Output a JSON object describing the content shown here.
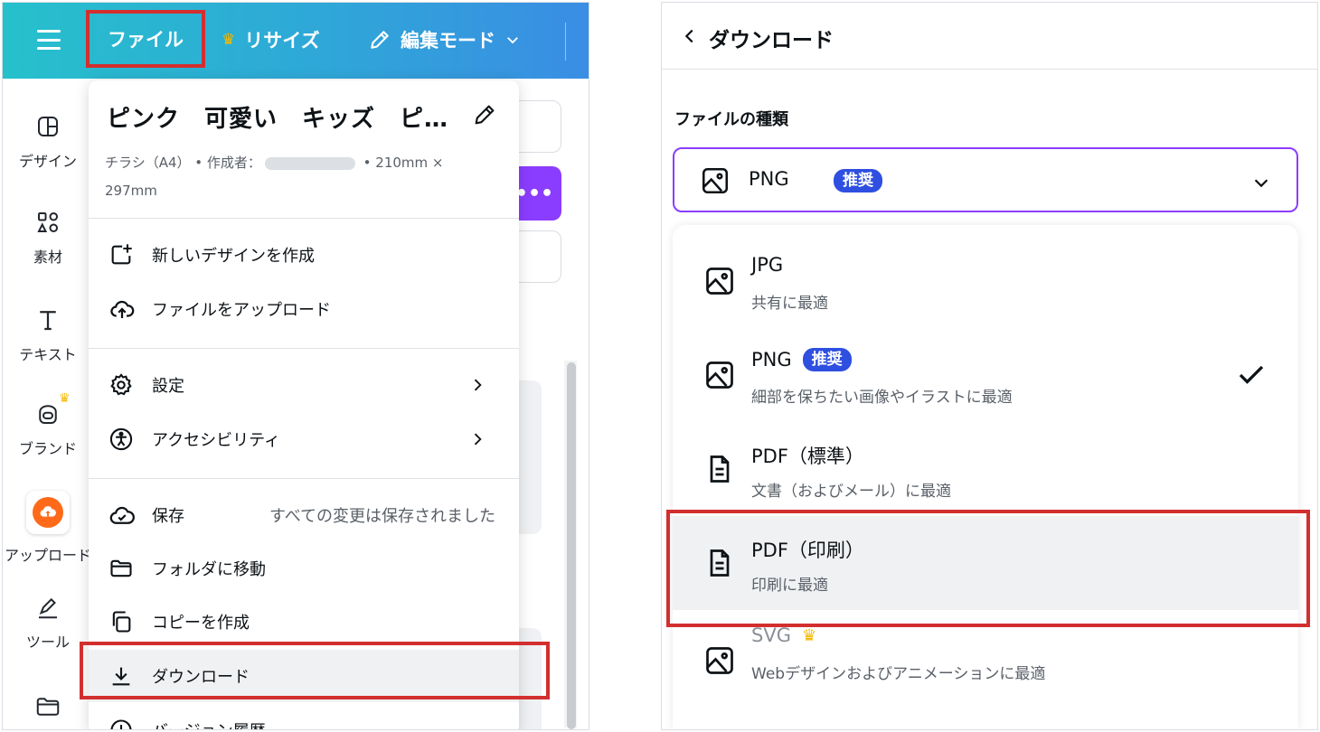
{
  "left": {
    "topbar": {
      "file_label": "ファイル",
      "resize_label": "リサイズ",
      "edit_mode_label": "編集モード"
    },
    "sidebar": {
      "items": [
        {
          "label": "デザイン",
          "icon": "design-icon"
        },
        {
          "label": "素材",
          "icon": "elements-icon"
        },
        {
          "label": "テキスト",
          "icon": "text-icon"
        },
        {
          "label": "ブランド",
          "icon": "brand-icon"
        },
        {
          "label": "アップロード",
          "icon": "upload-icon"
        },
        {
          "label": "ツール",
          "icon": "tools-icon"
        },
        {
          "label": "",
          "icon": "folder-icon"
        }
      ]
    },
    "file_menu": {
      "title": "ピンク　可愛い　キッズ　ピ…",
      "meta_prefix": "チラシ（A4） • 作成者：",
      "meta_suffix": " • 210mm × 297mm",
      "items": {
        "new_design": "新しいデザインを作成",
        "upload": "ファイルをアップロード",
        "settings": "設定",
        "accessibility": "アクセシビリティ",
        "save": "保存",
        "save_status": "すべての変更は保存されました",
        "move_folder": "フォルダに移動",
        "copy": "コピーを作成",
        "download": "ダウンロード",
        "version_history": "バージョン履歴"
      }
    }
  },
  "right": {
    "header_title": "ダウンロード",
    "section_label": "ファイルの種類",
    "selected": {
      "value": "PNG",
      "badge": "推奨"
    },
    "options": [
      {
        "name": "JPG",
        "badge": "",
        "desc": "共有に最適"
      },
      {
        "name": "PNG",
        "badge": "推奨",
        "desc": "細部を保ちたい画像やイラストに最適"
      },
      {
        "name": "PDF（標準）",
        "badge": "",
        "desc": "文書（およびメール）に最適"
      },
      {
        "name": "PDF（印刷）",
        "badge": "",
        "desc": "印刷に最適"
      },
      {
        "name": "SVG",
        "badge": "",
        "desc": "Webデザインおよびアニメーションに最適"
      }
    ]
  },
  "colors": {
    "topbar_gradient_start": "#26c0cc",
    "topbar_gradient_end": "#3a8de4",
    "highlight_red": "#d32f2f",
    "accent_purple": "#8b3dff",
    "badge_blue": "#2e4fe0",
    "crown_gold": "#f5b800",
    "upload_orange": "#ff6a1a"
  }
}
